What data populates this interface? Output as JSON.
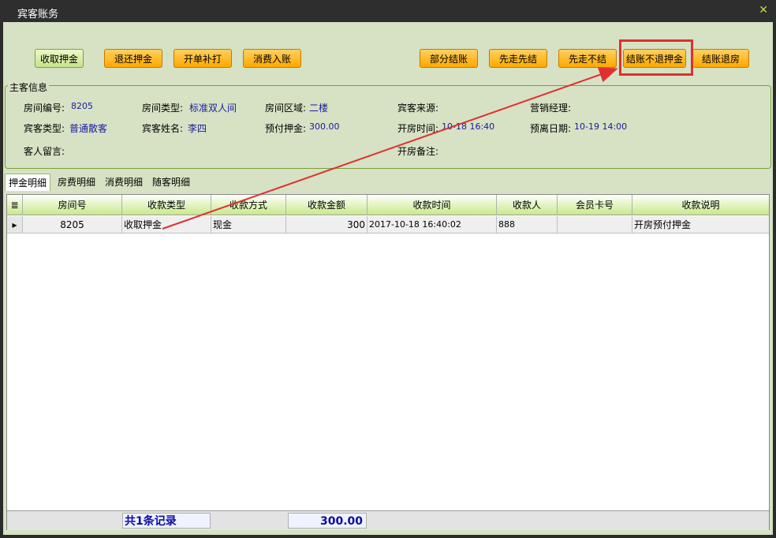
{
  "window": {
    "title": "宾客账务"
  },
  "toolbar": {
    "left": [
      "收取押金",
      "退还押金",
      "开单补打",
      "消费入账"
    ],
    "right": [
      "部分结账",
      "先走先结",
      "先走不结",
      "结账不退押金",
      "结账退房"
    ]
  },
  "guest_info": {
    "title": "主客信息",
    "room_no_label": "房间编号:",
    "room_no": "8205",
    "room_type_label": "房间类型:",
    "room_type": "标准双人间",
    "room_area_label": "房间区域:",
    "room_area": "二楼",
    "guest_source_label": "宾客来源:",
    "guest_source": "",
    "sales_manager_label": "营销经理:",
    "sales_manager": "",
    "guest_type_label": "宾客类型:",
    "guest_type": "普通散客",
    "guest_name_label": "宾客姓名:",
    "guest_name": "李四",
    "prepaid_label": "预付押金:",
    "prepaid": "300.00",
    "checkin_time_label": "开房时间:",
    "checkin_time": "10-18 16:40",
    "checkout_date_label": "预离日期:",
    "checkout_date": "10-19 14:00",
    "message_label": "客人留言:",
    "message": "",
    "note_label": "开房备注:",
    "note": ""
  },
  "tabs": [
    "押金明细",
    "房费明细",
    "消费明细",
    "随客明细"
  ],
  "table": {
    "columns": [
      "房间号",
      "收款类型",
      "收款方式",
      "收款金额",
      "收款时间",
      "收款人",
      "会员卡号",
      "收款说明"
    ],
    "rows": [
      [
        "8205",
        "收取押金",
        "现金",
        "300",
        "2017-10-18 16:40:02",
        "888",
        "",
        "开房预付押金"
      ]
    ]
  },
  "footer": {
    "count": "共1条记录",
    "sum": "300.00"
  },
  "colors": {
    "accent_red": "#e03030",
    "button_orange": "#ffa800",
    "panel_green": "#d6e2c3"
  },
  "icons": {
    "close": "close-icon",
    "grid_menu": "grid-menu-icon",
    "row_pointer": "row-pointer-icon"
  }
}
